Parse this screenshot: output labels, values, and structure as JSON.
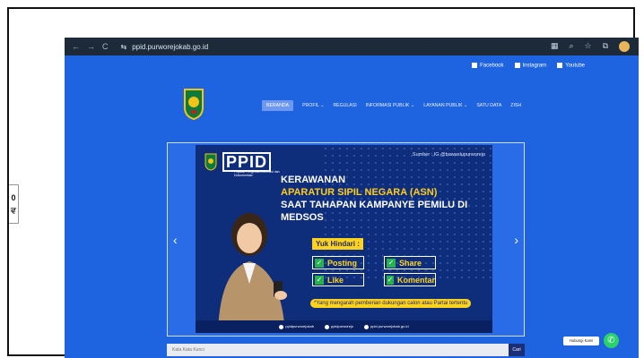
{
  "side_widget": {
    "top_char": "0",
    "bottom_char": "ਵ"
  },
  "browser": {
    "url": "ppid.purworejokab.go.id",
    "nav_back": "←",
    "nav_forward": "→",
    "nav_reload": "C"
  },
  "social_links": [
    {
      "label": "Facebook"
    },
    {
      "label": "Instagram"
    },
    {
      "label": "Youtube"
    }
  ],
  "menu": [
    {
      "label": "BERANDA",
      "active": true
    },
    {
      "label": "PROFIL ⌄"
    },
    {
      "label": "REGULASI"
    },
    {
      "label": "INFORMASI PUBLIK ⌄"
    },
    {
      "label": "LAYANAN PUBLIK ⌄"
    },
    {
      "label": "SATU DATA"
    },
    {
      "label": "ZISH"
    }
  ],
  "banner": {
    "brand": "PPID",
    "brand_sub": "Pejabat Pengelola Informasi dan Dokumentasi",
    "source": "Sumber : IG @bawaslupurworejo",
    "headline_1": "KERAWANAN",
    "headline_2": "APARATUR SIPIL NEGARA (ASN)",
    "headline_3": "SAAT TAHAPAN KAMPANYE PEMILU DI MEDSOS",
    "avoid_label": "Yuk Hindari :",
    "items": [
      "Posting",
      "Share",
      "Like",
      "Komentar"
    ],
    "note": "*Yang mengarah pemberian dukungan calon atau Partai tertentu",
    "footer": [
      "ppidpurworejokab",
      "ppidpurworejo",
      "ppid.purworejokab.go.id"
    ]
  },
  "slider": {
    "prev": "‹",
    "next": "›"
  },
  "search": {
    "placeholder": "Kata Kata Kunci",
    "button": "Cari"
  },
  "chat": {
    "label": "Hubungi Kami"
  },
  "colors": {
    "page_blue": "#1e64e0",
    "banner_navy": "#0e2d7a",
    "accent_yellow": "#ffd21e",
    "whatsapp": "#2bd26a"
  }
}
